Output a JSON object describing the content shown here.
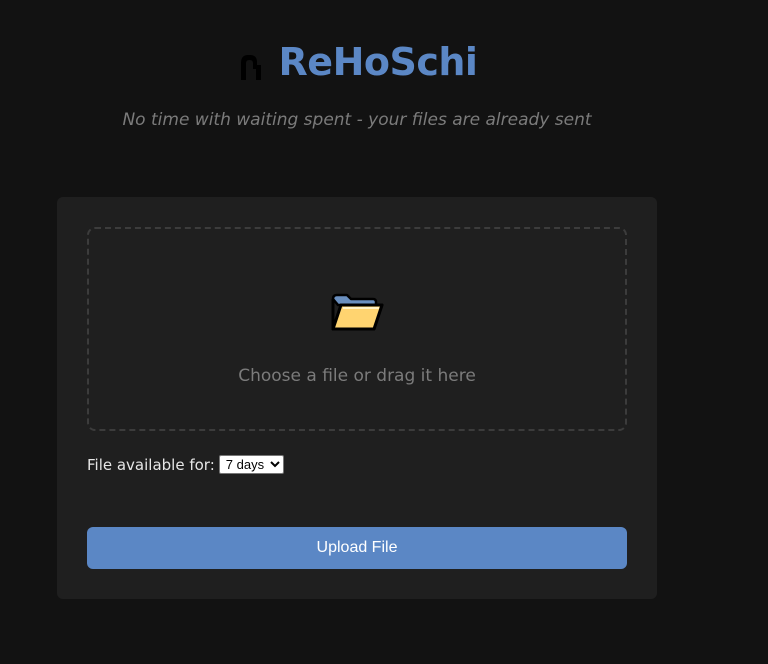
{
  "header": {
    "logo_icon": "hanger-hook-icon",
    "title": "ReHoSchi",
    "tagline": "No time with waiting spent - your files are already sent"
  },
  "upload_card": {
    "dropzone": {
      "icon": "folder-icon",
      "label": "Choose a file or drag it here"
    },
    "expiry": {
      "label": "File available for:",
      "selected": "7 days"
    },
    "upload_button_label": "Upload File"
  },
  "colors": {
    "background": "#121212",
    "card": "#1f1f1f",
    "accent": "#5b87c5",
    "muted_text": "#7b7b7b"
  }
}
